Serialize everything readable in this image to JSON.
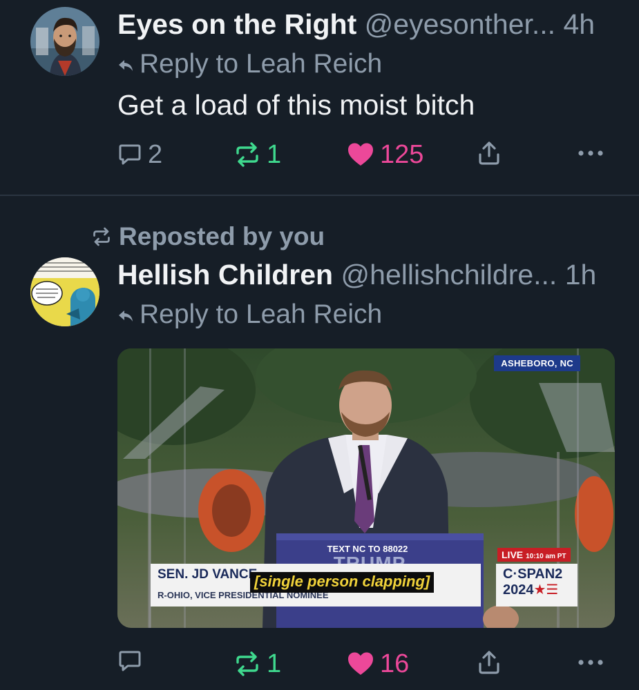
{
  "posts": [
    {
      "display_name": "Eyes on the Right",
      "handle": "@eyesonther...",
      "time": "4h",
      "reply_to": "Reply to Leah Reich",
      "text": "Get a load of this moist bitch",
      "counts": {
        "replies": "2",
        "reposts": "1",
        "likes": "125"
      },
      "avatar_icon": "bearded-cartoon-man-avatar"
    },
    {
      "repost_banner": "Reposted by you",
      "display_name": "Hellish Children",
      "handle": "@hellishchildre...",
      "time": "1h",
      "reply_to": "Reply to Leah Reich",
      "counts": {
        "replies": "",
        "reposts": "1",
        "likes": "16"
      },
      "avatar_icon": "comic-panel-avatar",
      "media": {
        "location_tag": "ASHEBORO, NC",
        "podium_small": "TEXT NC TO 88022",
        "podium_big": "TRUMP",
        "lower_third_name": "SEN. JD VANCE",
        "lower_third_title": "R-OHIO, VICE PRESIDENTIAL NOMINEE",
        "caption": "[single person clapping]",
        "live_label": "LIVE",
        "live_time": "10:10 am PT",
        "network": "C·SPAN2",
        "network_year": "2024"
      }
    }
  ],
  "colors": {
    "background": "#161e27",
    "text_primary": "#f1f3f5",
    "text_secondary": "#8e9cab",
    "repost_green": "#3fd98e",
    "like_pink": "#ec4899",
    "divider": "#2b3541"
  },
  "icons": {
    "reply": "speech-bubble-icon",
    "repost": "repost-arrows-icon",
    "like": "heart-icon",
    "share": "share-up-arrow-icon",
    "more": "ellipsis-icon",
    "reply_indicator": "reply-arrow-icon"
  }
}
